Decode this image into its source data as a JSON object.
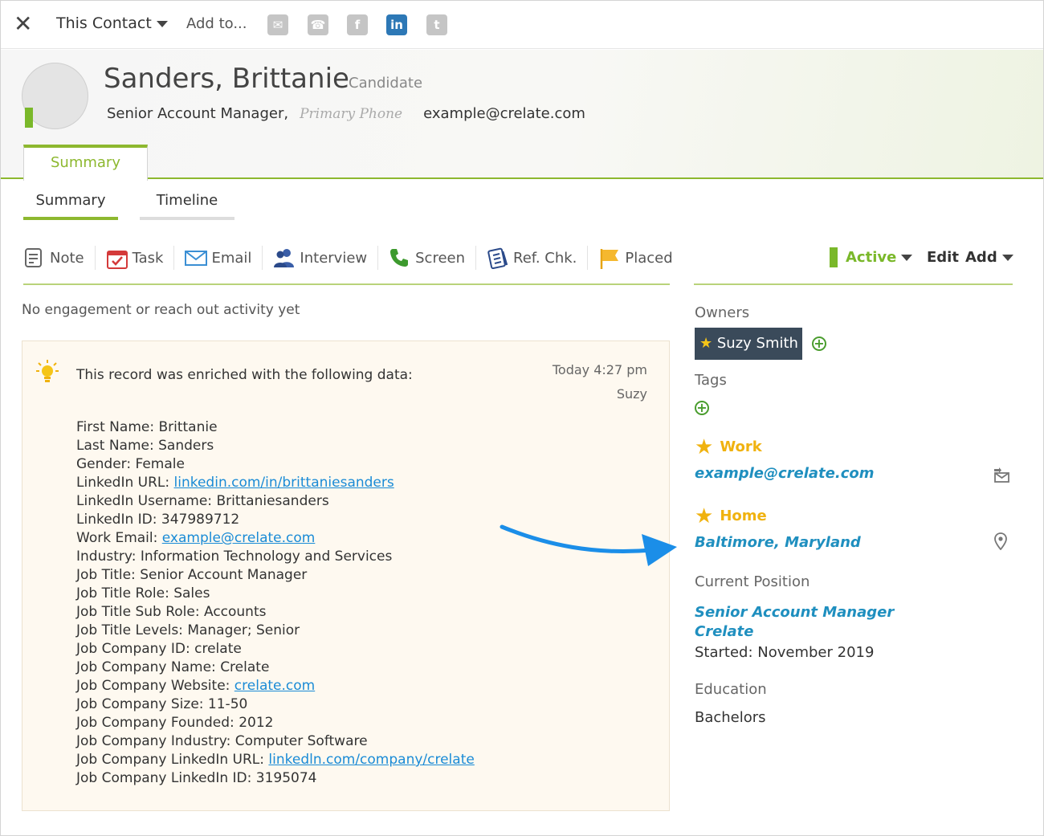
{
  "toolbar": {
    "close_glyph": "✕",
    "contact_menu": "This Contact",
    "add_to": "Add to...",
    "social": [
      {
        "name": "email",
        "glyph": "✉"
      },
      {
        "name": "phone",
        "glyph": "☎"
      },
      {
        "name": "facebook",
        "glyph": "f"
      },
      {
        "name": "linkedin",
        "glyph": "in"
      },
      {
        "name": "twitter",
        "glyph": "t"
      }
    ]
  },
  "contact": {
    "name": "Sanders, Brittanie",
    "type": "Candidate",
    "title": "Senior Account Manager,",
    "phone_placeholder": "Primary Phone",
    "email": "example@crelate.com"
  },
  "main_tab": "Summary",
  "sub_tabs": [
    "Summary",
    "Timeline"
  ],
  "actions": [
    "Note",
    "Task",
    "Email",
    "Interview",
    "Screen",
    "Ref. Chk.",
    "Placed"
  ],
  "status": {
    "label": "Active",
    "color": "#7ab82a"
  },
  "edit_label": "Edit",
  "add_label": "Add",
  "no_activity": "No engagement or reach out activity yet",
  "enrichment": {
    "title": "This record was enriched with the following data:",
    "time": "Today 4:27 pm",
    "user": "Suzy",
    "fields": [
      {
        "label": "First Name:",
        "value": "Brittanie"
      },
      {
        "label": "Last Name:",
        "value": "Sanders"
      },
      {
        "label": "Gender:",
        "value": "Female"
      },
      {
        "label": "LinkedIn URL:",
        "link": "linkedin.com/in/brittaniesanders"
      },
      {
        "label": "LinkedIn Username:",
        "value": "Brittaniesanders"
      },
      {
        "label": "LinkedIn ID:",
        "value": "347989712"
      },
      {
        "label": "Work Email:",
        "link": "example@crelate.com"
      },
      {
        "label": "Industry:",
        "value": "Information Technology and Services"
      },
      {
        "label": "Job Title:",
        "value": "Senior Account Manager"
      },
      {
        "label": "Job Title Role:",
        "value": "Sales"
      },
      {
        "label": "Job Title Sub Role:",
        "value": "Accounts"
      },
      {
        "label": "Job Title Levels:",
        "value": "Manager; Senior"
      },
      {
        "label": "Job Company ID:",
        "value": "crelate"
      },
      {
        "label": "Job Company Name:",
        "value": "Crelate"
      },
      {
        "label": "Job Company Website:",
        "link": "crelate.com"
      },
      {
        "label": "Job Company Size:",
        "value": "11-50"
      },
      {
        "label": "Job Company Founded:",
        "value": "2012"
      },
      {
        "label": "Job Company Industry:",
        "value": "Computer Software"
      },
      {
        "label": "Job Company LinkedIn URL:",
        "link": "linkedln.com/company/crelate"
      },
      {
        "label": "Job Company LinkedIn ID:",
        "value": "3195074"
      }
    ]
  },
  "sidebar": {
    "owners_label": "Owners",
    "owner": "Suzy Smith",
    "tags_label": "Tags",
    "work_label": "Work",
    "work_email": "example@crelate.com",
    "home_label": "Home",
    "home_location": "Baltimore, Maryland",
    "position_label": "Current Position",
    "position_title": "Senior Account Manager",
    "position_company": "Crelate",
    "position_started": "Started: November 2019",
    "education_label": "Education",
    "education_value": "Bachelors"
  },
  "colors": {
    "accent_green": "#8db82f",
    "link_blue": "#1f8fbf",
    "owner_bg": "#3a4a5a",
    "star": "#f0b20f"
  }
}
